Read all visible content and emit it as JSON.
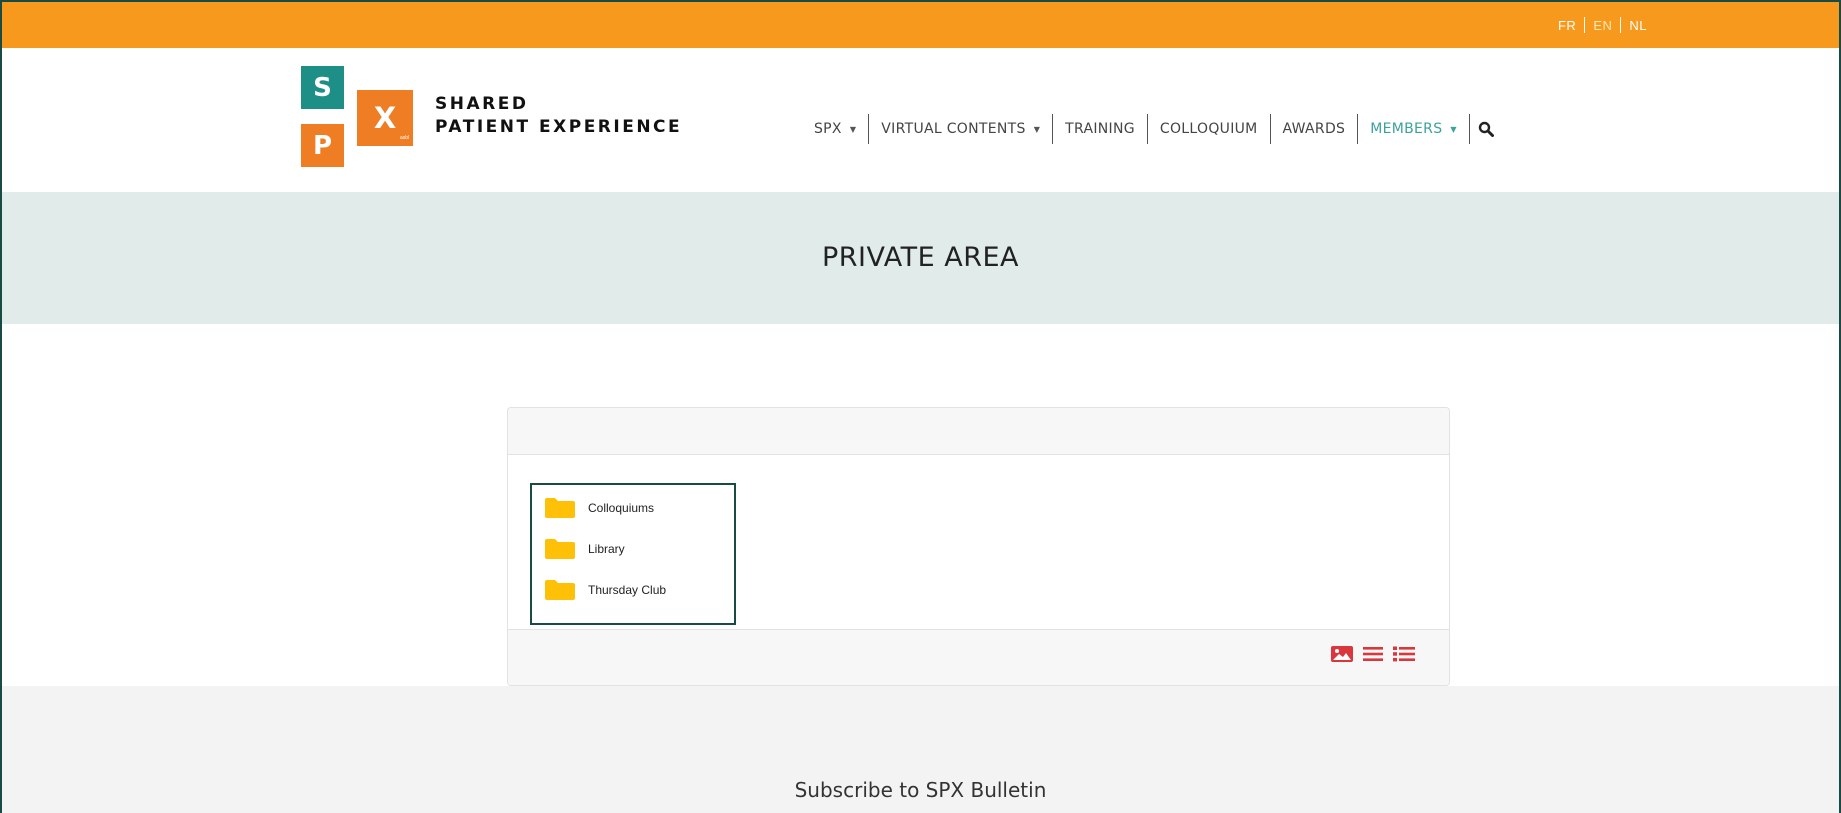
{
  "languages": [
    {
      "code": "FR",
      "active": false
    },
    {
      "code": "EN",
      "active": true
    },
    {
      "code": "NL",
      "active": false
    }
  ],
  "logo": {
    "letters": [
      "S",
      "X",
      "P"
    ],
    "small_text": "asbl",
    "brand_line1": "SHARED",
    "brand_line2": "PATIENT EXPERIENCE",
    "colors": {
      "teal": "#1d8f87",
      "orange": "#ef7d23"
    }
  },
  "nav": {
    "items": [
      {
        "label": "SPX",
        "dropdown": true
      },
      {
        "label": "VIRTUAL CONTENTS",
        "dropdown": true
      },
      {
        "label": "TRAINING",
        "dropdown": false
      },
      {
        "label": "COLLOQUIUM",
        "dropdown": false
      },
      {
        "label": "AWARDS",
        "dropdown": false
      },
      {
        "label": "MEMBERS",
        "dropdown": true,
        "active": true
      }
    ],
    "search_icon": "search-icon"
  },
  "banner": {
    "title": "PRIVATE AREA"
  },
  "folders": [
    {
      "name": "Colloquiums",
      "icon": "folder-icon"
    },
    {
      "name": "Library",
      "icon": "folder-icon"
    },
    {
      "name": "Thursday Club",
      "icon": "folder-icon"
    }
  ],
  "view_modes": [
    "image-view-icon",
    "list-view-icon",
    "detailed-list-view-icon"
  ],
  "footer": {
    "subscribe": "Subscribe to SPX Bulletin"
  },
  "colors": {
    "topbar": "#f7991c",
    "banner_bg": "#e1ecea",
    "folder": "#ffc107",
    "view_icons": "#d9363e",
    "active_nav": "#3aa39b"
  }
}
